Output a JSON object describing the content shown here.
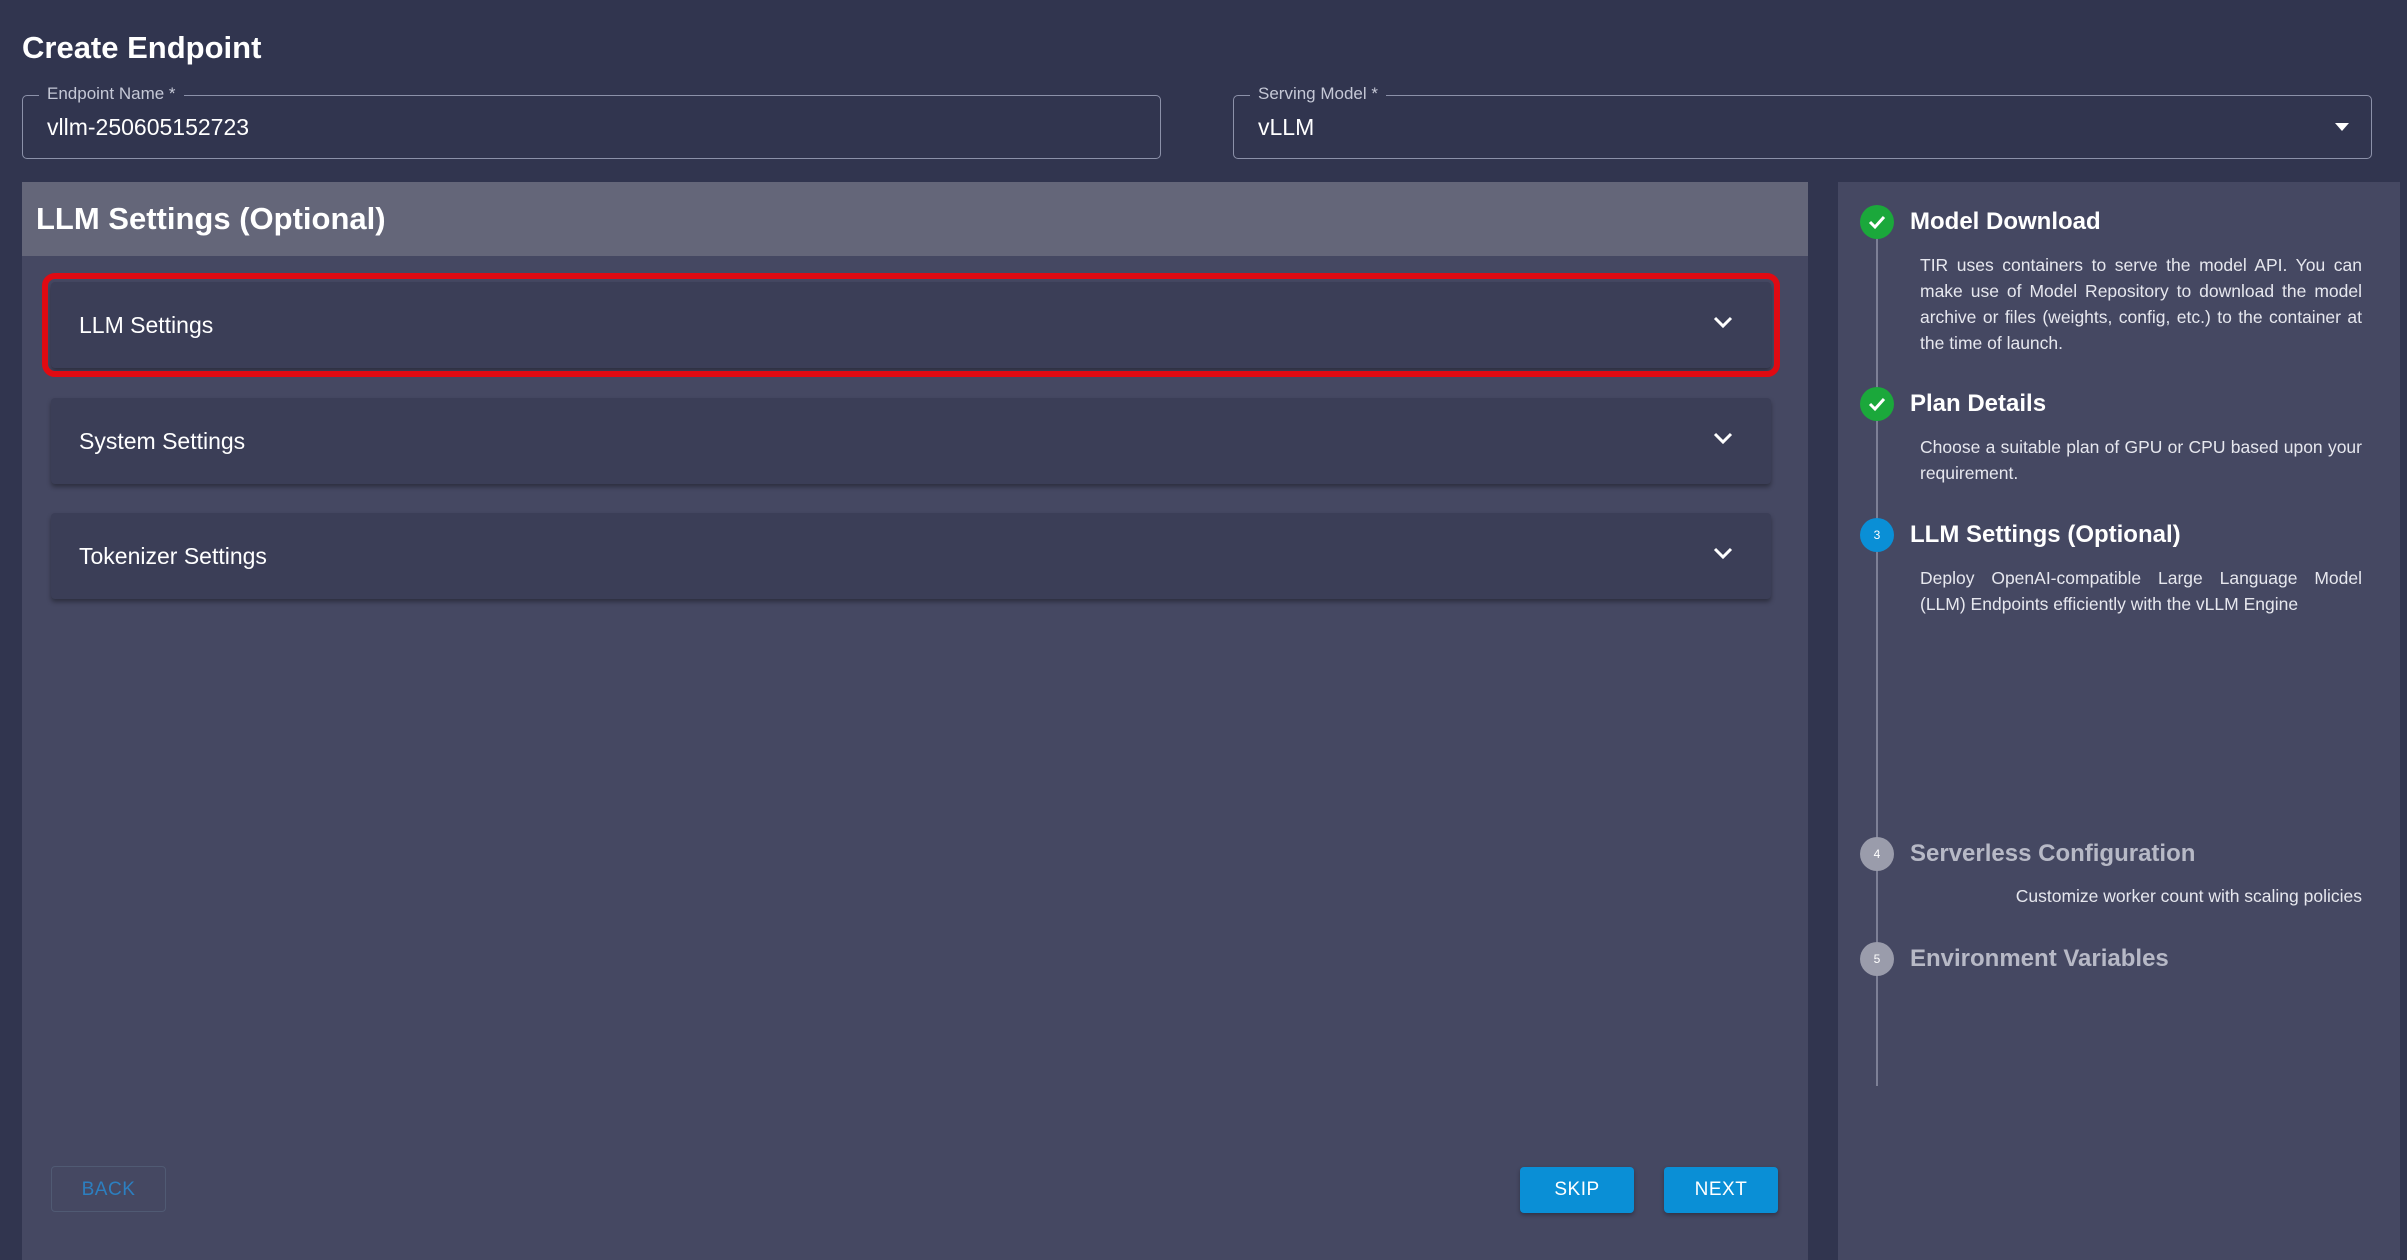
{
  "page": {
    "title": "Create Endpoint"
  },
  "form": {
    "endpoint_name": {
      "label": "Endpoint Name *",
      "value": "vllm-250605152723"
    },
    "serving_model": {
      "label": "Serving Model *",
      "value": "vLLM"
    }
  },
  "main": {
    "header": "LLM Settings (Optional)",
    "accordions": [
      {
        "label": "LLM Settings"
      },
      {
        "label": "System Settings"
      },
      {
        "label": "Tokenizer Settings"
      }
    ],
    "buttons": {
      "back": "BACK",
      "skip": "SKIP",
      "next": "NEXT"
    }
  },
  "steps": [
    {
      "number": "1",
      "status": "done",
      "title": "Model Download",
      "description": "TIR uses containers to serve the model API. You can make use of Model Repository to download the model archive or files (weights, config, etc.) to the container at the time of launch."
    },
    {
      "number": "2",
      "status": "done",
      "title": "Plan Details",
      "description": "Choose a suitable plan of GPU or CPU based upon your requirement."
    },
    {
      "number": "3",
      "status": "active",
      "title": "LLM Settings (Optional)",
      "description": "Deploy OpenAI-compatible Large Language Model (LLM) Endpoints efficiently with the vLLM Engine"
    },
    {
      "number": "4",
      "status": "pending",
      "title": "Serverless Configuration",
      "description": "Customize worker count with scaling policies"
    },
    {
      "number": "5",
      "status": "pending",
      "title": "Environment Variables",
      "description": ""
    }
  ],
  "colors": {
    "background": "#31354f",
    "panel": "#454862",
    "accent": "#0a8fd6",
    "success": "#1ba83b",
    "highlight": "#e00a12"
  }
}
